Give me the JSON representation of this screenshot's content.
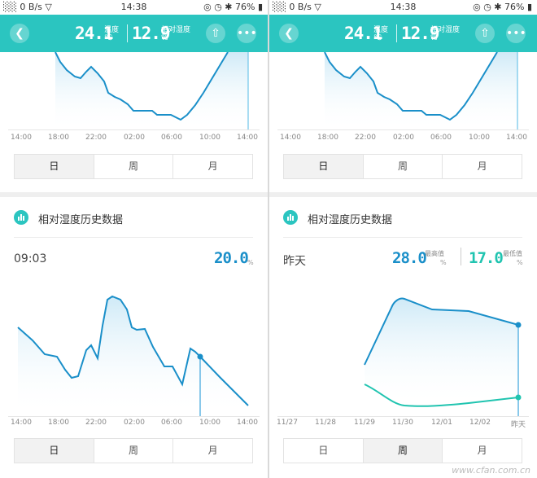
{
  "status_bar": {
    "left": "░░ 0 B/s ▽",
    "time": "14:38",
    "right": "◎ ◷ ✱ 76% ▮"
  },
  "header": {
    "temperature": "24.1",
    "temperature_label": "温度",
    "temperature_unit": "℃",
    "humidity": "12.9",
    "humidity_label": "相对湿度",
    "humidity_unit": "%",
    "back_icon": "chevron-left-icon",
    "share_icon": "share-icon",
    "more_icon": "more-icon"
  },
  "accent_color": "#2bc5c0",
  "line_color": "#1a8fc9",
  "teal_line_color": "#20c4b0",
  "left": {
    "top_chart": {
      "x_ticks": [
        "14:00",
        "18:00",
        "22:00",
        "02:00",
        "06:00",
        "10:00",
        "14:00"
      ]
    },
    "top_tabs": [
      "日",
      "周",
      "月"
    ],
    "top_active": 0,
    "section_title": "相对湿度历史数据",
    "reading": {
      "time": "09:03",
      "value": "20.0",
      "unit": "%"
    },
    "bottom_chart": {
      "x_ticks": [
        "14:00",
        "18:00",
        "22:00",
        "02:00",
        "06:00",
        "10:00",
        "14:00"
      ]
    },
    "bottom_tabs": [
      "日",
      "周",
      "月"
    ],
    "bottom_active": 0
  },
  "right": {
    "top_chart": {
      "x_ticks": [
        "14:00",
        "18:00",
        "22:00",
        "02:00",
        "06:00",
        "10:00",
        "14:00"
      ]
    },
    "top_tabs": [
      "日",
      "周",
      "月"
    ],
    "top_active": 0,
    "section_title": "相对湿度历史数据",
    "reading": {
      "time": "昨天",
      "max_value": "28.0",
      "max_label": "最高值",
      "min_value": "17.0",
      "min_label": "最低值",
      "unit": "%"
    },
    "bottom_chart": {
      "x_ticks": [
        "11/27",
        "11/28",
        "11/29",
        "11/30",
        "12/01",
        "12/02",
        "昨天"
      ]
    },
    "bottom_tabs": [
      "日",
      "周",
      "月"
    ],
    "bottom_active": 1
  },
  "watermark": "www.cfan.com.cn"
}
